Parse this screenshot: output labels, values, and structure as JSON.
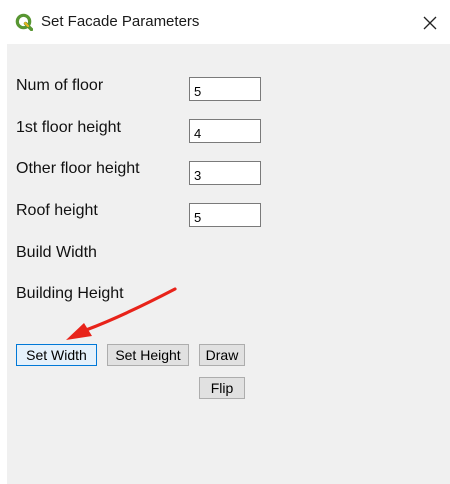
{
  "window": {
    "title": "Set Facade Parameters",
    "app_icon": "qgis-logo-icon",
    "close_icon": "close-icon"
  },
  "form": {
    "num_floor_label": "Num of floor",
    "num_floor_value": "5",
    "first_floor_label": "1st floor height",
    "first_floor_value": "4",
    "other_floor_label": "Other floor height",
    "other_floor_value": "3",
    "roof_label": "Roof height",
    "roof_value": "5",
    "build_width_label": "Build Width",
    "building_height_label": "Building Height"
  },
  "buttons": {
    "set_width": "Set Width",
    "set_height": "Set Height",
    "draw": "Draw",
    "flip": "Flip"
  },
  "colors": {
    "accent": "#0078d7",
    "annotation_arrow": "#e8231a",
    "qgis_green": "#589632",
    "qgis_yellow": "#eeb422"
  }
}
